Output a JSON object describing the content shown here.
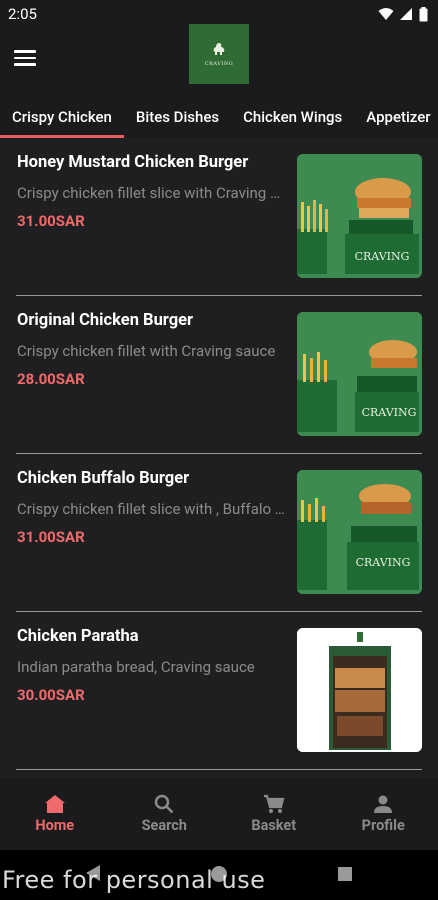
{
  "status_bar": {
    "time": "2:05"
  },
  "header": {
    "logo_text": "CRAVING"
  },
  "tabs": [
    {
      "label": "Crispy Chicken",
      "active": true
    },
    {
      "label": "Bites Dishes",
      "active": false
    },
    {
      "label": "Chicken Wings",
      "active": false
    },
    {
      "label": "Appetizer",
      "active": false
    }
  ],
  "menu_items": [
    {
      "title": "Honey Mustard Chicken Burger",
      "description": "Crispy chicken fillet slice with Craving sauce",
      "price": "31.00SAR"
    },
    {
      "title": "Original Chicken Burger",
      "description": "Crispy chicken fillet with Craving sauce",
      "price": "28.00SAR"
    },
    {
      "title": "Chicken Buffalo Burger",
      "description": "Crispy chicken fillet slice with , Buffalo sauce",
      "price": "31.00SAR"
    },
    {
      "title": "Chicken Paratha",
      "description": "Indian paratha bread, Craving sauce",
      "price": "30.00SAR"
    }
  ],
  "bottom_nav": [
    {
      "label": "Home",
      "icon": "home-icon",
      "active": true
    },
    {
      "label": "Search",
      "icon": "search-icon",
      "active": false
    },
    {
      "label": "Basket",
      "icon": "cart-icon",
      "active": false
    },
    {
      "label": "Profile",
      "icon": "person-icon",
      "active": false
    }
  ],
  "watermark": "Free for personal use",
  "colors": {
    "accent": "#ef6a6a",
    "background": "#1f1f22",
    "brand_green": "#2f6c33"
  }
}
